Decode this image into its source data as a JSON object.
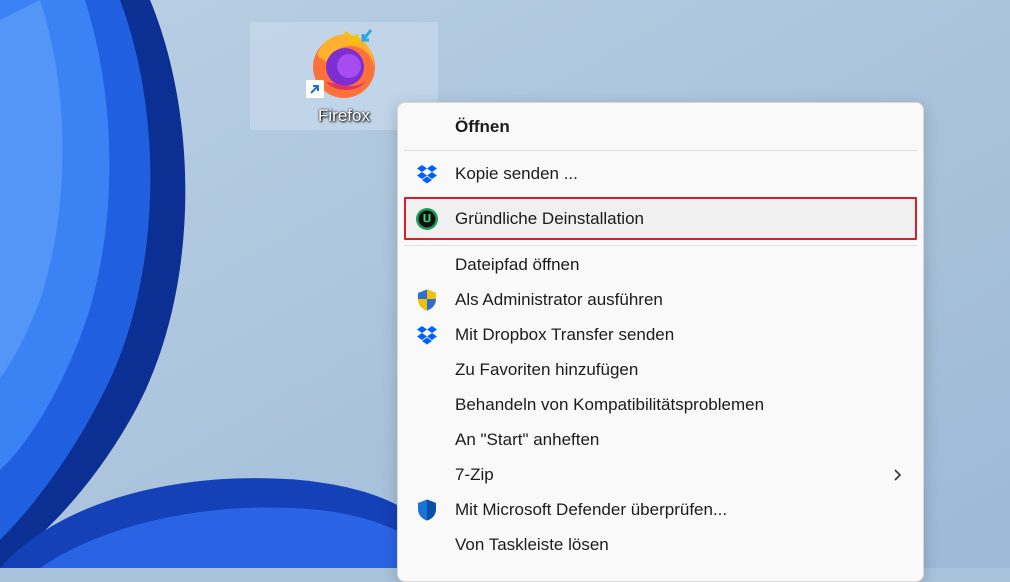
{
  "desktop": {
    "shortcut": {
      "label": "Firefox",
      "icon": "firefox-icon"
    }
  },
  "context_menu": {
    "items": [
      {
        "label": "Öffnen",
        "icon": "",
        "bold": true
      },
      {
        "label": "Kopie senden ...",
        "icon": "dropbox-icon"
      },
      {
        "label": "Gründliche Deinstallation",
        "icon": "uninstaller-icon",
        "highlighted": true
      },
      {
        "label": "Dateipfad öffnen",
        "icon": ""
      },
      {
        "label": "Als Administrator ausführen",
        "icon": "uac-shield-icon"
      },
      {
        "label": "Mit Dropbox Transfer senden",
        "icon": "dropbox-icon"
      },
      {
        "label": "Zu Favoriten hinzufügen",
        "icon": ""
      },
      {
        "label": "Behandeln von Kompatibilitätsproblemen",
        "icon": ""
      },
      {
        "label": "An \"Start\" anheften",
        "icon": ""
      },
      {
        "label": "7-Zip",
        "icon": "",
        "submenu": true
      },
      {
        "label": "Mit Microsoft Defender überprüfen...",
        "icon": "defender-shield-icon"
      },
      {
        "label": "Von Taskleiste lösen",
        "icon": ""
      }
    ]
  },
  "colors": {
    "highlight_border": "#d5202b",
    "dropbox": "#0061fe",
    "uninstaller": "#1e9e5a",
    "defender": "#1a74d8"
  }
}
